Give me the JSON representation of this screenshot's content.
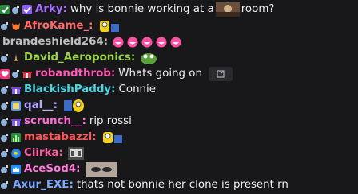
{
  "messages": [
    {
      "user": "Arky",
      "color": "#a970ff",
      "text_before": "why is bonnie working at a",
      "text_after": "room?",
      "emote": "room-emote"
    },
    {
      "user": "AfroKame_",
      "color": "#ff6b6b",
      "emote": "minion-emote"
    },
    {
      "user": "brandeshield264",
      "color": "#bfbfbf",
      "emote": "laughing-emotes"
    },
    {
      "user": "David_Aeroponics",
      "color": "#9ad34a",
      "emote": "pepe-emote"
    },
    {
      "user": "robandthrob",
      "color": "#ff5ab4",
      "text": "Whats going on"
    },
    {
      "user": "BlackishPaddy",
      "color": "#4ad6e0",
      "text": "Connie"
    },
    {
      "user": "qal__",
      "color": "#b9a6ff",
      "emote": "minion-emote"
    },
    {
      "user": "scrunch__",
      "color": "#ff6bd2",
      "text": "rip rossi"
    },
    {
      "user": "mastabazzi",
      "color": "#ff5757",
      "emote": "minion-emote"
    },
    {
      "user": "Ciirka",
      "color": "#ff5fa2",
      "emote": "gg-emote"
    },
    {
      "user": "AceSod4",
      "color": "#ff7ad9",
      "emote": "face-emote"
    },
    {
      "user": "Axur_EXE",
      "color": "#7aa7ff",
      "text": "thats not bonnie her clone is present rn"
    }
  ]
}
